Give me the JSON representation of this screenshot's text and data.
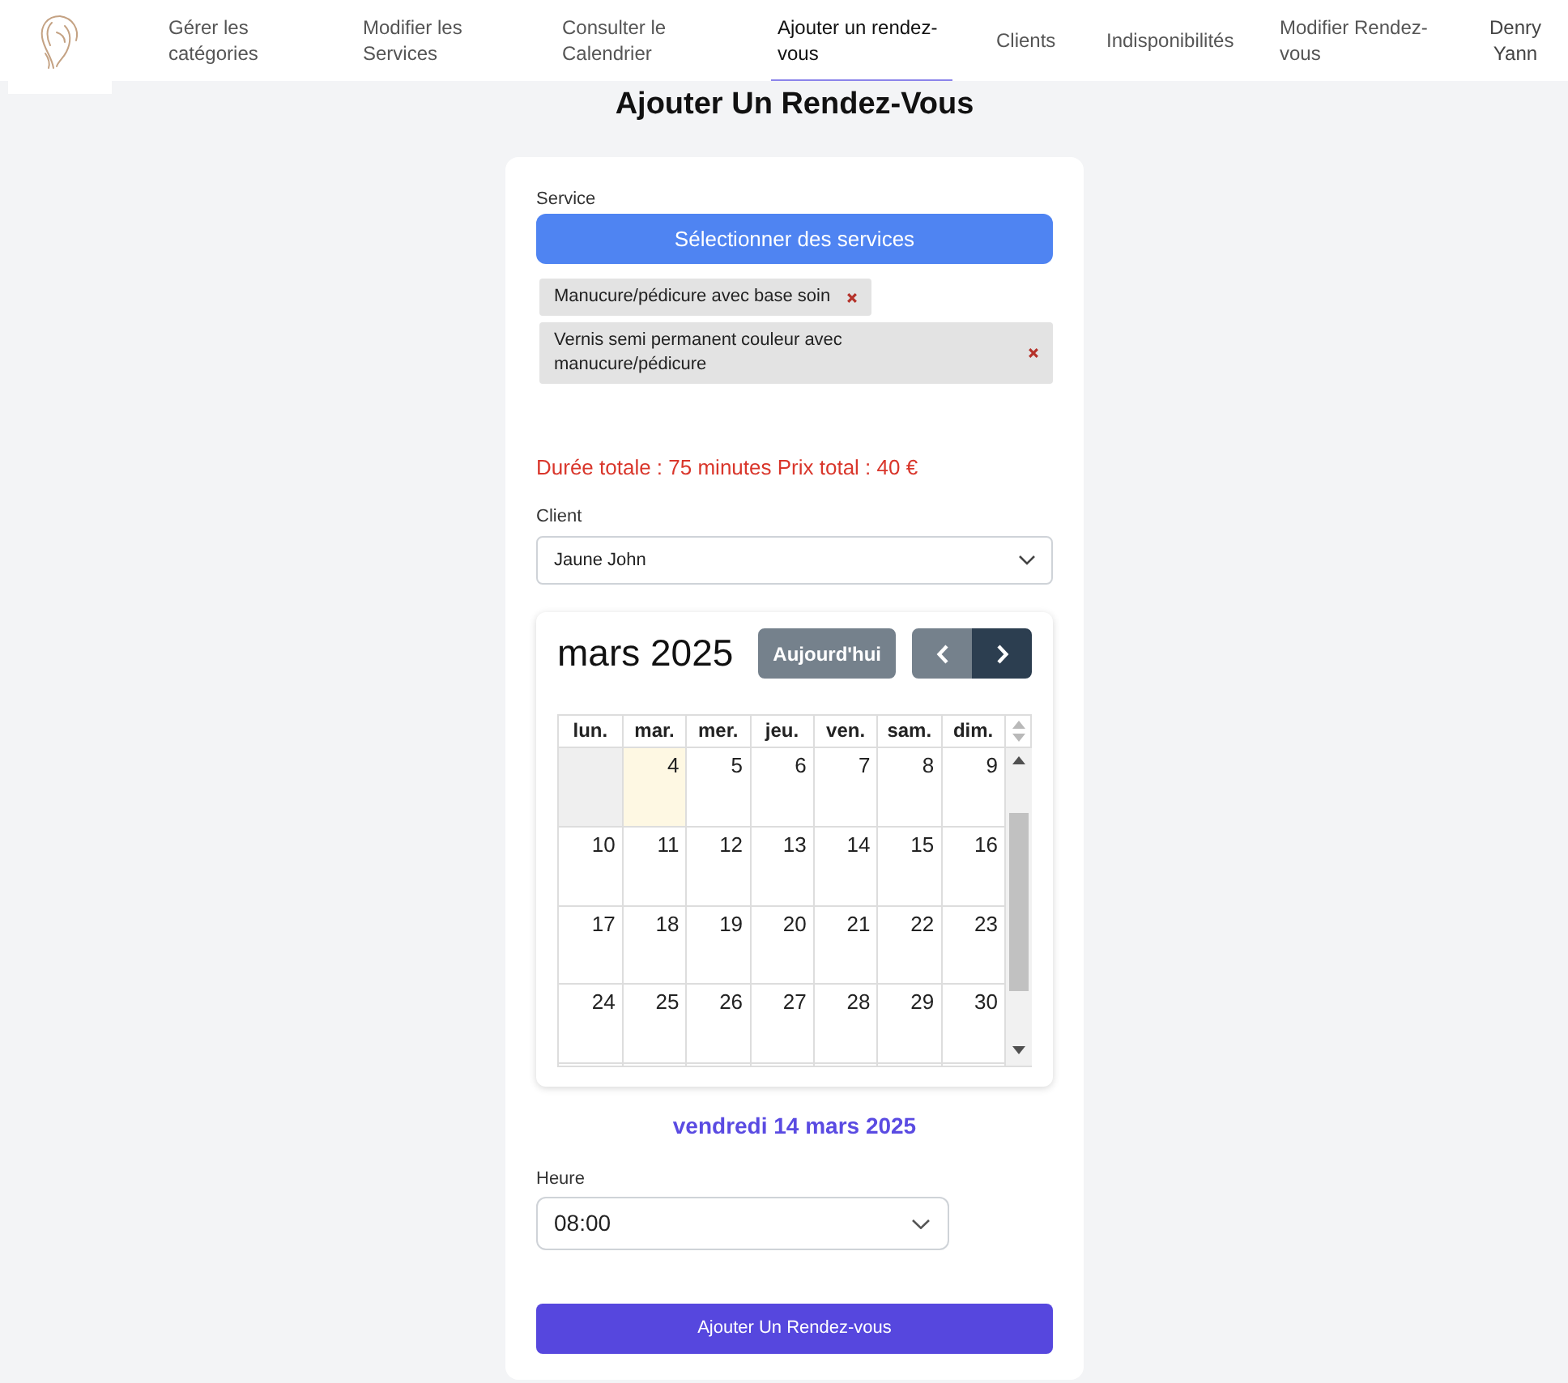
{
  "navbar": {
    "items": [
      {
        "label": "Gérer les catégories",
        "selected": false
      },
      {
        "label": "Modifier les Services",
        "selected": false
      },
      {
        "label": "Consulter le Calendrier",
        "selected": false
      },
      {
        "label": "Ajouter un rendez-vous",
        "selected": true
      },
      {
        "label": "Clients",
        "selected": false
      },
      {
        "label": "Indisponibilités",
        "selected": false
      },
      {
        "label": "Modifier Rendez-vous",
        "selected": false
      }
    ],
    "user": "Denry Yann"
  },
  "page_title": "Ajouter Un Rendez-Vous",
  "service": {
    "label": "Service",
    "button": "Sélectionner des services",
    "selected_services": [
      {
        "name": "Manucure/pédicure avec base soin"
      },
      {
        "name": "Vernis semi permanent couleur avec manucure/pédicure"
      }
    ]
  },
  "summary": "Durée totale : 75 minutes Prix total : 40 €",
  "client": {
    "label": "Client",
    "value": "Jaune John"
  },
  "calendar": {
    "title": "mars 2025",
    "today_button": {
      "label": "Aujourd'hui",
      "disabled": true
    },
    "nav_buttons": [
      {
        "kind": "prev",
        "disabled": true
      },
      {
        "kind": "next",
        "disabled": false
      }
    ],
    "weekdays": [
      "lun.",
      "mar.",
      "mer.",
      "jeu.",
      "ven.",
      "sam.",
      "dim."
    ],
    "weeks": [
      [
        {
          "disabled": true,
          "today": false
        },
        {
          "day": "4",
          "disabled": false,
          "today": true
        },
        {
          "day": "5",
          "disabled": false,
          "today": false
        },
        {
          "day": "6",
          "disabled": false,
          "today": false
        },
        {
          "day": "7",
          "disabled": false,
          "today": false
        },
        {
          "day": "8",
          "disabled": false,
          "today": false
        },
        {
          "day": "9",
          "disabled": false,
          "today": false
        }
      ],
      [
        {
          "day": "10",
          "disabled": false,
          "today": false
        },
        {
          "day": "11",
          "disabled": false,
          "today": false
        },
        {
          "day": "12",
          "disabled": false,
          "today": false
        },
        {
          "day": "13",
          "disabled": false,
          "today": false
        },
        {
          "day": "14",
          "disabled": false,
          "today": false
        },
        {
          "day": "15",
          "disabled": false,
          "today": false
        },
        {
          "day": "16",
          "disabled": false,
          "today": false
        }
      ],
      [
        {
          "day": "17",
          "disabled": false,
          "today": false
        },
        {
          "day": "18",
          "disabled": false,
          "today": false
        },
        {
          "day": "19",
          "disabled": false,
          "today": false
        },
        {
          "day": "20",
          "disabled": false,
          "today": false
        },
        {
          "day": "21",
          "disabled": false,
          "today": false
        },
        {
          "day": "22",
          "disabled": false,
          "today": false
        },
        {
          "day": "23",
          "disabled": false,
          "today": false
        }
      ],
      [
        {
          "day": "24",
          "disabled": false,
          "today": false
        },
        {
          "day": "25",
          "disabled": false,
          "today": false
        },
        {
          "day": "26",
          "disabled": false,
          "today": false
        },
        {
          "day": "27",
          "disabled": false,
          "today": false
        },
        {
          "day": "28",
          "disabled": false,
          "today": false
        },
        {
          "day": "29",
          "disabled": false,
          "today": false
        },
        {
          "day": "30",
          "disabled": false,
          "today": false
        }
      ]
    ]
  },
  "selected_date": "vendredi 14 mars 2025",
  "time": {
    "label": "Heure",
    "value": "08:00"
  },
  "submit_button": "Ajouter Un Rendez-vous"
}
